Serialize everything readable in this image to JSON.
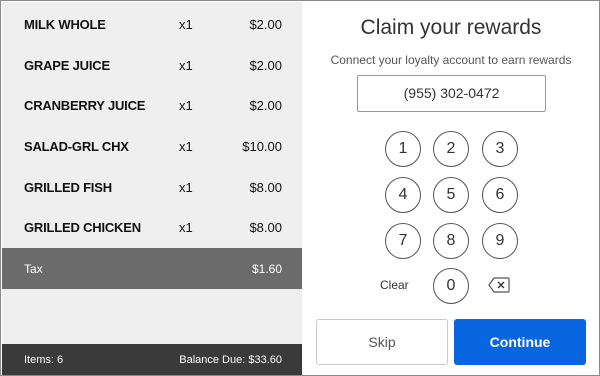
{
  "order": {
    "items": [
      {
        "name": "MILK WHOLE",
        "qty": "x1",
        "price": "$2.00"
      },
      {
        "name": "GRAPE JUICE",
        "qty": "x1",
        "price": "$2.00"
      },
      {
        "name": "CRANBERRY JUICE",
        "qty": "x1",
        "price": "$2.00"
      },
      {
        "name": "SALAD-GRL CHX",
        "qty": "x1",
        "price": "$10.00"
      },
      {
        "name": "GRILLED FISH",
        "qty": "x1",
        "price": "$8.00"
      },
      {
        "name": "GRILLED CHICKEN",
        "qty": "x1",
        "price": "$8.00"
      }
    ],
    "tax_label": "Tax",
    "tax_amount": "$1.60",
    "items_count": "Items: 6",
    "balance_due": "Balance Due: $33.60"
  },
  "rewards": {
    "title": "Claim your rewards",
    "subtitle": "Connect your loyalty account to earn rewards",
    "phone_value": "(955) 302-0472",
    "keys": [
      "1",
      "2",
      "3",
      "4",
      "5",
      "6",
      "7",
      "8",
      "9",
      "0"
    ],
    "clear_label": "Clear",
    "backspace_icon": "backspace-icon",
    "skip_label": "Skip",
    "continue_label": "Continue",
    "continue_color": "#0a66e0"
  }
}
